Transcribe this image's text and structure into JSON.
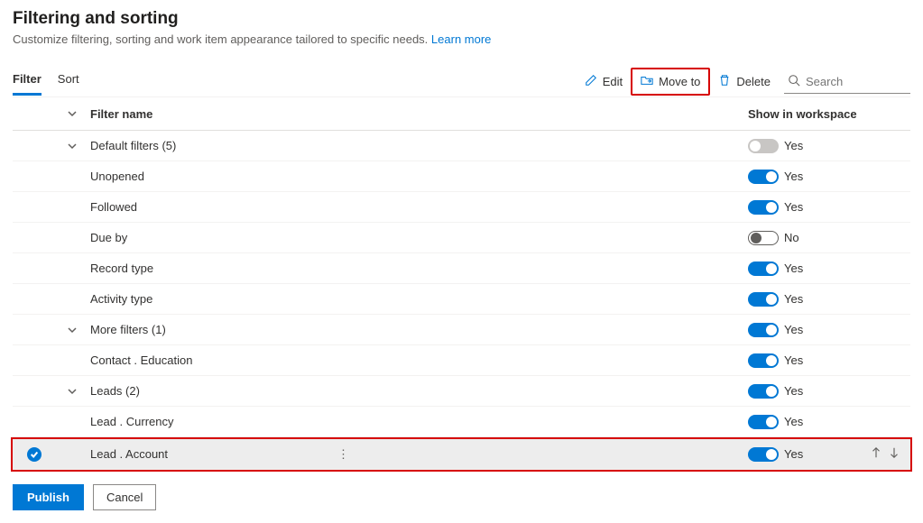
{
  "header": {
    "title": "Filtering and sorting",
    "description": "Customize filtering, sorting and work item appearance tailored to specific needs.",
    "learn_more": "Learn more"
  },
  "tabs": [
    {
      "label": "Filter",
      "active": true
    },
    {
      "label": "Sort",
      "active": false
    }
  ],
  "commands": {
    "edit": "Edit",
    "move_to": "Move to",
    "delete": "Delete"
  },
  "search": {
    "placeholder": "Search"
  },
  "columns": {
    "filter_name": "Filter name",
    "show_in_workspace": "Show in workspace"
  },
  "toggle_labels": {
    "yes": "Yes",
    "no": "No"
  },
  "rows": [
    {
      "type": "group",
      "label": "Default filters (5)",
      "expanded": true,
      "toggle": "disabled",
      "toggle_label": "Yes"
    },
    {
      "type": "item",
      "label": "Unopened",
      "toggle": "on",
      "toggle_label": "Yes"
    },
    {
      "type": "item",
      "label": "Followed",
      "toggle": "on",
      "toggle_label": "Yes"
    },
    {
      "type": "item",
      "label": "Due by",
      "toggle": "off",
      "toggle_label": "No"
    },
    {
      "type": "item",
      "label": "Record type",
      "toggle": "on",
      "toggle_label": "Yes"
    },
    {
      "type": "item",
      "label": "Activity type",
      "toggle": "on",
      "toggle_label": "Yes"
    },
    {
      "type": "group",
      "label": "More filters (1)",
      "expanded": true,
      "toggle": "on",
      "toggle_label": "Yes"
    },
    {
      "type": "item",
      "label": "Contact . Education",
      "toggle": "on",
      "toggle_label": "Yes"
    },
    {
      "type": "group",
      "label": "Leads (2)",
      "expanded": true,
      "toggle": "on",
      "toggle_label": "Yes"
    },
    {
      "type": "item",
      "label": "Lead . Currency",
      "toggle": "on",
      "toggle_label": "Yes"
    },
    {
      "type": "item",
      "label": "Lead . Account",
      "toggle": "on",
      "toggle_label": "Yes",
      "selected": true,
      "show_arrows": true,
      "highlighted": true
    }
  ],
  "footer": {
    "publish": "Publish",
    "cancel": "Cancel"
  }
}
